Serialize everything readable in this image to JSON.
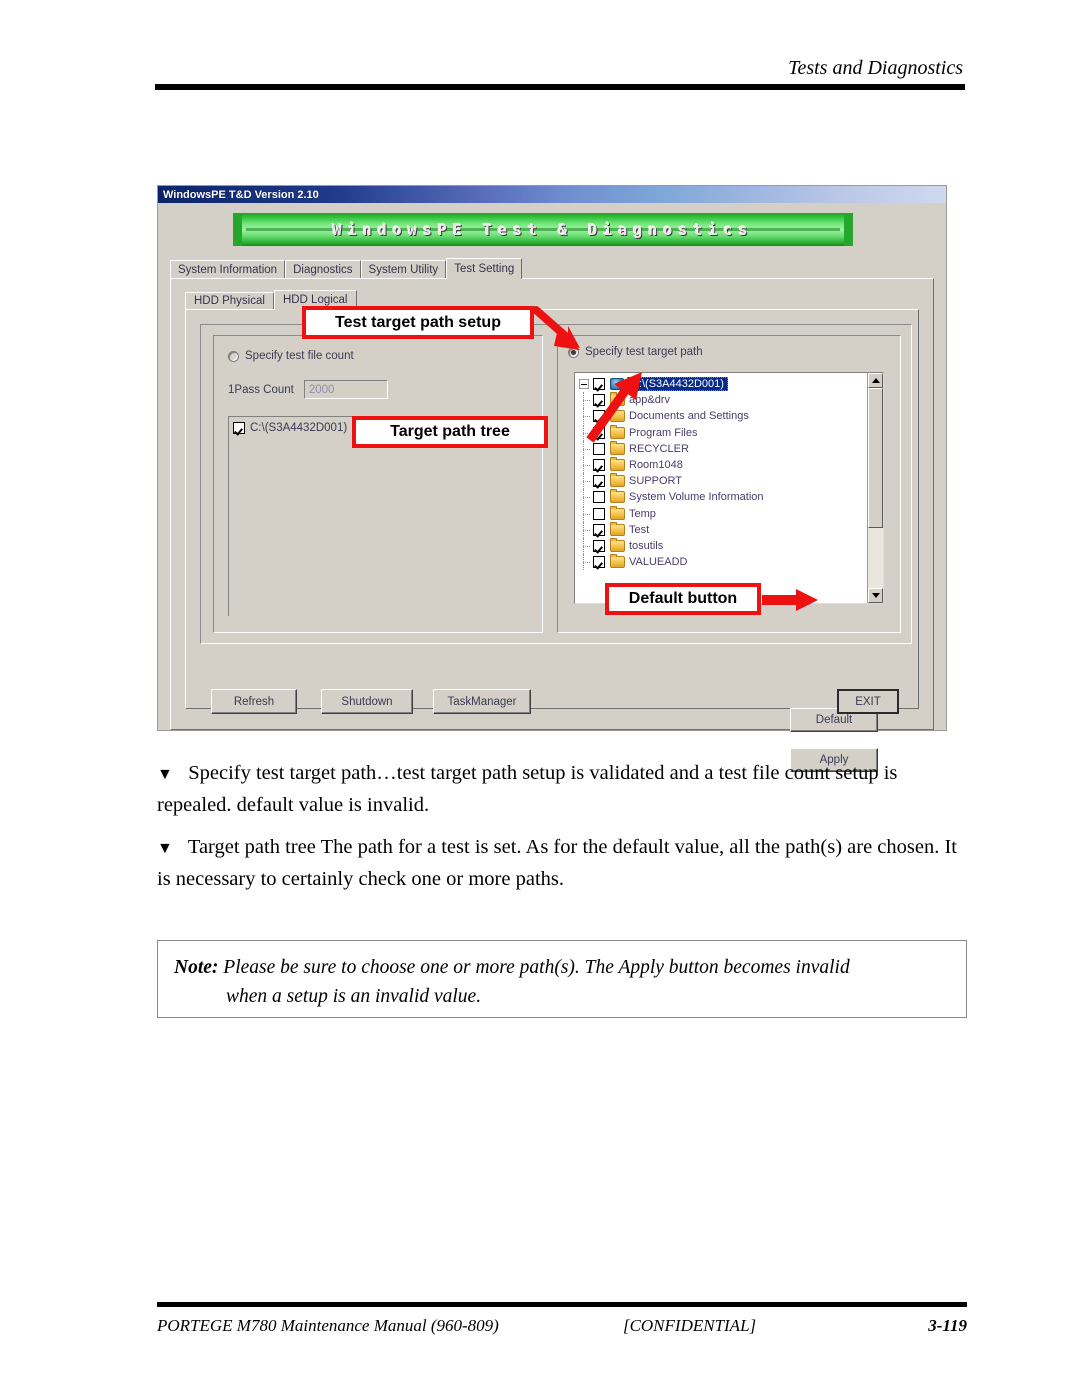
{
  "page": {
    "header_title": "Tests and Diagnostics"
  },
  "screenshot": {
    "titlebar": {
      "text": "WindowsPE T&D Version 2.10"
    },
    "banner": {
      "text": "WindowsPE Test & Diagnostics"
    },
    "tabs": [
      {
        "label": "System Information",
        "active": false
      },
      {
        "label": "Diagnostics",
        "active": false
      },
      {
        "label": "System Utility",
        "active": false
      },
      {
        "label": "Test Setting",
        "active": true
      }
    ],
    "subtabs": [
      {
        "label": "HDD Physical",
        "active": false
      },
      {
        "label": "HDD Logical",
        "active": true
      }
    ],
    "left_panel": {
      "radio_label": "Specify test file count",
      "radio_checked": false,
      "pass_count_label": "1Pass Count",
      "pass_count_value": "2000",
      "list_items": [
        {
          "label": "C:\\(S3A4432D001)",
          "checked": true
        }
      ]
    },
    "right_panel": {
      "radio_label": "Specify test target path",
      "radio_checked": true,
      "tree": {
        "root": {
          "label": "C:\\(S3A4432D001)",
          "checked": true,
          "selected": true,
          "icon": "drive-icon"
        },
        "children": [
          {
            "label": "app&drv",
            "checked": true
          },
          {
            "label": "Documents and Settings",
            "checked": true
          },
          {
            "label": "Program Files",
            "checked": true
          },
          {
            "label": "RECYCLER",
            "checked": false
          },
          {
            "label": "Room1048",
            "checked": true
          },
          {
            "label": "SUPPORT",
            "checked": true
          },
          {
            "label": "System Volume Information",
            "checked": false
          },
          {
            "label": "Temp",
            "checked": false
          },
          {
            "label": "Test",
            "checked": true
          },
          {
            "label": "tosutils",
            "checked": true
          },
          {
            "label": "VALUEADD",
            "checked": true
          }
        ]
      }
    },
    "buttons": {
      "default": "Default",
      "apply": "Apply",
      "refresh": "Refresh",
      "shutdown": "Shutdown",
      "taskmanager": "TaskManager",
      "exit": "EXIT"
    },
    "callouts": {
      "setup": "Test target path setup",
      "tree": "Target path tree",
      "default_button": "Default button"
    },
    "colors": {
      "annotation_red": "#ee1111",
      "dialog_face": "#d4d0c8",
      "titlebar_blue": "#0a246a",
      "banner_green": "#35c43d",
      "selection_blue": "#0a2a8a"
    }
  },
  "body": {
    "para1": {
      "bullet": "▼",
      "text": "Specify test target path…test target path setup is validated and a test file count setup is repealed. default value is invalid."
    },
    "para2": {
      "bullet": "▼",
      "text": "Target path tree   The path for a test is set. As for the default value, all the path(s) are chosen. It is necessary to certainly check one or more paths."
    },
    "note": {
      "label": "Note:",
      "line1": " Please be sure to choose one or more path(s). The Apply button becomes invalid",
      "line2": "when a setup is an invalid value."
    }
  },
  "footer": {
    "left": "PORTEGE M780 Maintenance Manual (960-809)",
    "center": "[CONFIDENTIAL]",
    "right": "3-119"
  }
}
